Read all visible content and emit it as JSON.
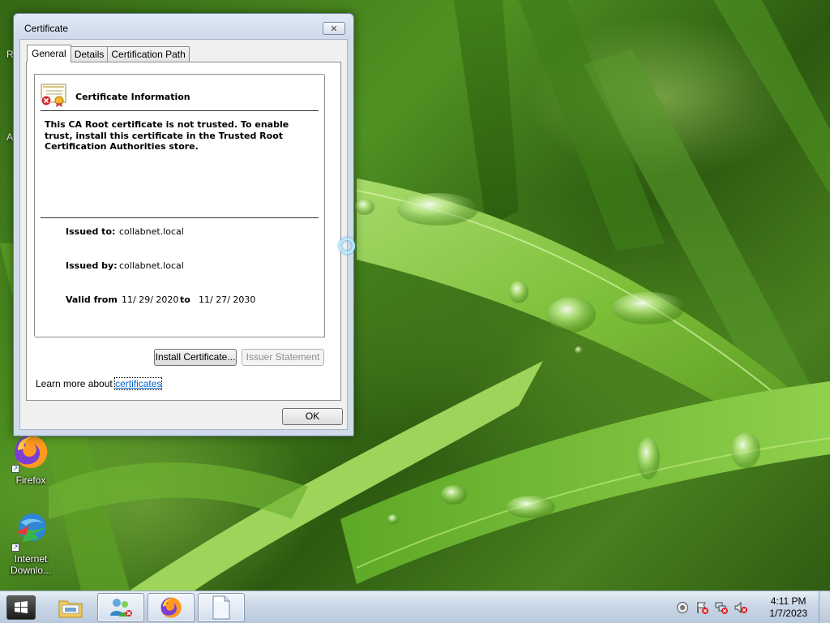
{
  "desktop": {
    "icons": [
      {
        "label": "Firefox"
      },
      {
        "label": "Internet Downlo..."
      }
    ],
    "edge_fragments": [
      "R",
      "A"
    ]
  },
  "dialog": {
    "title": "Certificate",
    "close_glyph": "✕",
    "tabs": [
      {
        "label": "General",
        "active": true
      },
      {
        "label": "Details",
        "active": false
      },
      {
        "label": "Certification Path",
        "active": false
      }
    ],
    "info_title": "Certificate Information",
    "warning": "This CA Root certificate is not trusted. To enable trust, install this certificate in the Trusted Root Certification Authorities store.",
    "issued_to_label": "Issued to:",
    "issued_to_value": "collabnet.local",
    "issued_by_label": "Issued by:",
    "issued_by_value": "collabnet.local",
    "valid_from_label": "Valid from",
    "valid_from_value": "11/ 29/ 2020",
    "valid_to_label": "to",
    "valid_to_value": "11/ 27/ 2030",
    "install_button": "Install Certificate...",
    "issuer_statement_button": "Issuer Statement",
    "learn_more_prefix": "Learn more about",
    "learn_more_link": "certificates",
    "ok_button": "OK"
  },
  "taskbar": {
    "time": "4:11 PM",
    "date": "1/7/2023",
    "buttons": [
      "file-explorer-icon",
      "network-users-icon",
      "firefox-icon",
      "document-icon"
    ],
    "tray": [
      "action-center-icon",
      "flag-alert-icon",
      "network-disconnected-icon",
      "volume-muted-icon"
    ]
  },
  "colors": {
    "link": "#0066cc",
    "dialog_frame": "#cfdbea",
    "wallpaper_green": "#4f9222"
  }
}
